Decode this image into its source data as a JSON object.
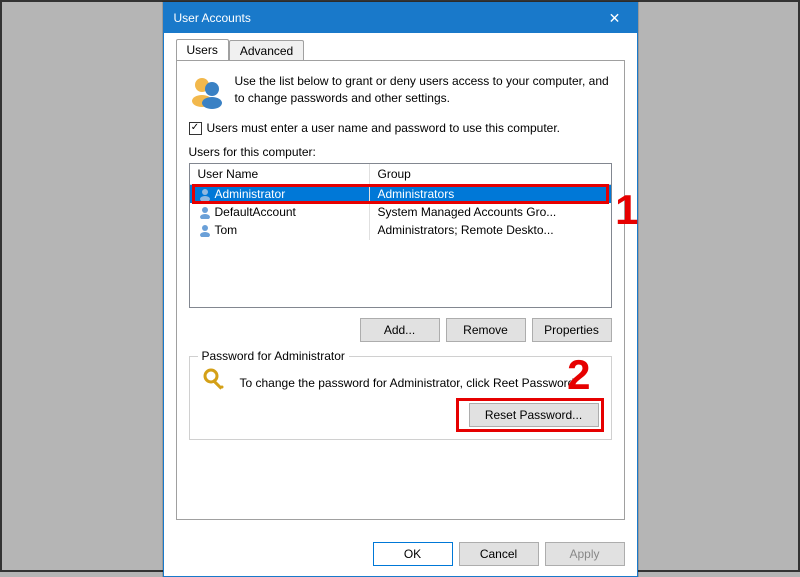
{
  "titlebar": {
    "title": "User Accounts",
    "close_label": "✕"
  },
  "tabs": {
    "users": "Users",
    "advanced": "Advanced"
  },
  "intro": "Use the list below to grant or deny users access to your computer, and to change passwords and other settings.",
  "checkbox": {
    "label": "Users must enter a user name and password to use this computer.",
    "checked": "✓"
  },
  "list": {
    "label": "Users for this computer:",
    "columns": {
      "name": "User Name",
      "group": "Group"
    },
    "rows": [
      {
        "name": "Administrator",
        "group": "Administrators",
        "selected": true
      },
      {
        "name": "DefaultAccount",
        "group": "System Managed Accounts Gro..."
      },
      {
        "name": "Tom",
        "group": "Administrators; Remote Deskto..."
      }
    ]
  },
  "buttons": {
    "add": "Add...",
    "remove": "Remove",
    "properties": "Properties"
  },
  "password_section": {
    "legend": "Password for Administrator",
    "text_before": "To change the password for Administrator, click Re",
    "text_after": "et Password.",
    "reset": "Reset Password..."
  },
  "dialog_buttons": {
    "ok": "OK",
    "cancel": "Cancel",
    "apply": "Apply"
  },
  "annotations": {
    "num1": "1",
    "num2": "2"
  }
}
